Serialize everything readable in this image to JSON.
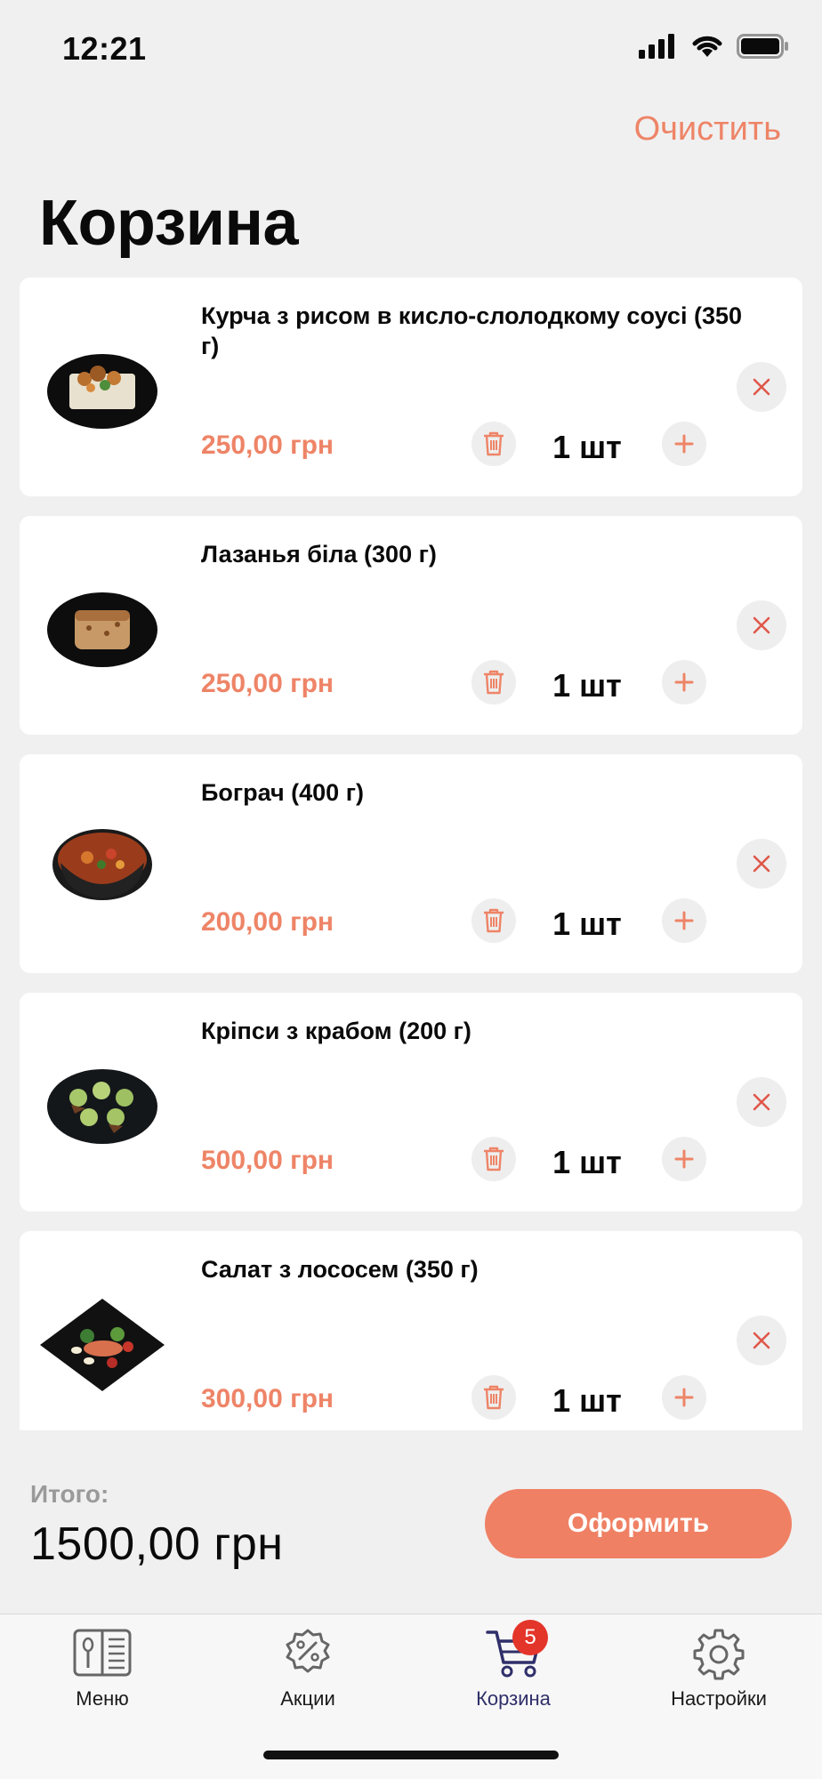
{
  "status_bar": {
    "time": "12:21"
  },
  "header": {
    "clear_label": "Очистить",
    "title": "Корзина"
  },
  "cart": {
    "items": [
      {
        "name": "Курча з рисом в кисло-слолодкому соусі (350 г)",
        "price": "250,00 грн",
        "qty": "1 шт",
        "image": "rice-dish-plate"
      },
      {
        "name": "Лазанья біла (300 г)",
        "price": "250,00 грн",
        "qty": "1 шт",
        "image": "lasagna-plate"
      },
      {
        "name": "Бограч (400 г)",
        "price": "200,00 грн",
        "qty": "1 шт",
        "image": "soup-bowl"
      },
      {
        "name": "Кріпси з крабом (200 г)",
        "price": "500,00 грн",
        "qty": "1 шт",
        "image": "crab-crisps-plate"
      },
      {
        "name": "Салат з лососем (350 г)",
        "price": "300,00 грн",
        "qty": "1 шт",
        "image": "salmon-salad-plate"
      }
    ]
  },
  "summary": {
    "total_label": "Итого:",
    "total_value": "1500,00 грн",
    "checkout_label": "Оформить"
  },
  "tabbar": {
    "tabs": [
      {
        "label": "Меню",
        "icon": "menu-book-icon"
      },
      {
        "label": "Акции",
        "icon": "discount-badge-icon"
      },
      {
        "label": "Корзина",
        "icon": "cart-icon",
        "badge": "5",
        "active": true
      },
      {
        "label": "Настройки",
        "icon": "settings-gear-icon"
      }
    ]
  },
  "colors": {
    "accent": "#ee8467",
    "background": "#f0f0f0",
    "badge": "#e4352a",
    "active_tab": "#2f2f6a"
  }
}
